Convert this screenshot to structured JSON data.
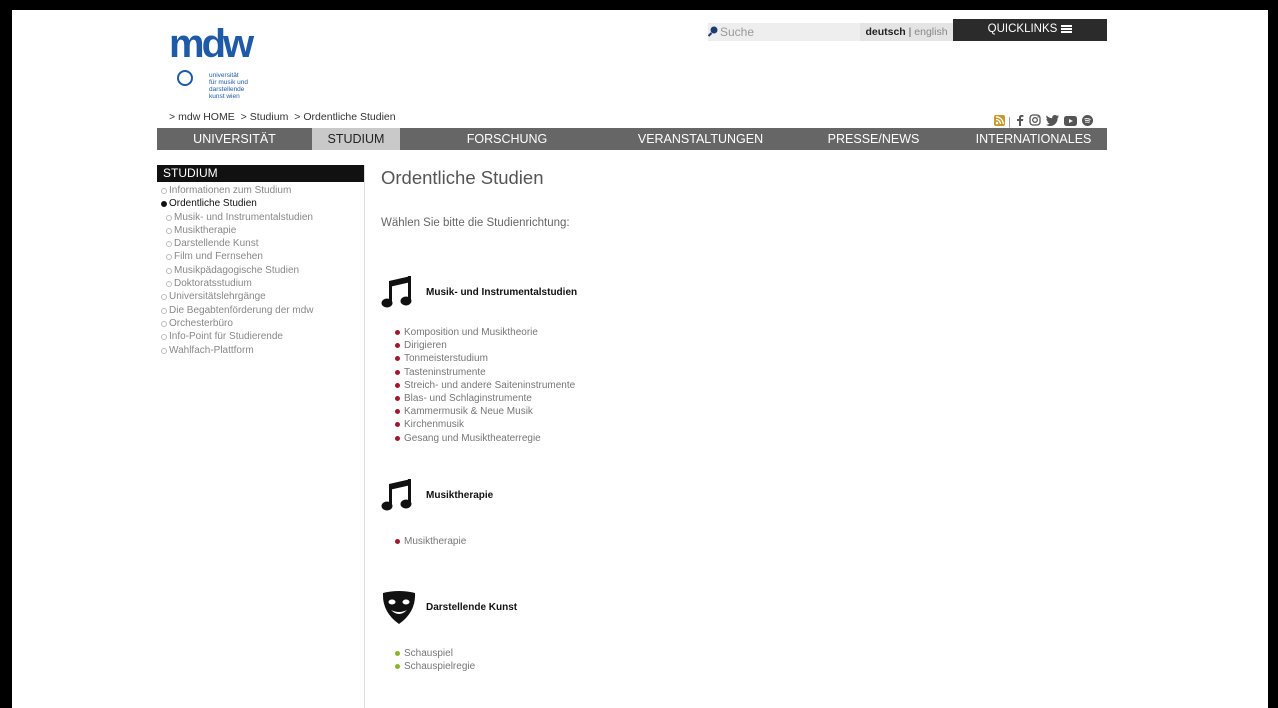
{
  "logo": {
    "text": "mdw",
    "tagline": [
      "universität",
      "für musik und",
      "darstellende",
      "kunst wien"
    ]
  },
  "breadcrumb": [
    ">",
    "mdw HOME",
    ">",
    "Studium",
    ">",
    "Ordentliche Studien"
  ],
  "search": {
    "placeholder": "Suche"
  },
  "language": {
    "active": "deutsch",
    "separator": "|",
    "other": "english"
  },
  "quicklinks": {
    "label": "QUICKLINKS"
  },
  "social_icons": [
    "rss-icon",
    "facebook-icon",
    "instagram-icon",
    "twitter-icon",
    "youtube-icon",
    "spotify-icon"
  ],
  "nav": {
    "items": [
      {
        "label": "UNIVERSITÄT",
        "active": false
      },
      {
        "label": "STUDIUM",
        "active": true
      },
      {
        "label": "FORSCHUNG",
        "active": false
      },
      {
        "label": "VERANSTALTUNGEN",
        "active": false
      },
      {
        "label": "PRESSE/NEWS",
        "active": false
      },
      {
        "label": "INTERNATIONALES",
        "active": false
      }
    ]
  },
  "sidebar": {
    "heading": "STUDIUM",
    "items": [
      {
        "label": "Informationen zum Studium",
        "level": 0,
        "active": false
      },
      {
        "label": "Ordentliche Studien",
        "level": 0,
        "active": true
      },
      {
        "label": "Musik- und Instrumentalstudien",
        "level": 1,
        "active": false
      },
      {
        "label": "Musiktherapie",
        "level": 1,
        "active": false
      },
      {
        "label": "Darstellende Kunst",
        "level": 1,
        "active": false
      },
      {
        "label": "Film und Fernsehen",
        "level": 1,
        "active": false
      },
      {
        "label": "Musikpädagogische Studien",
        "level": 1,
        "active": false
      },
      {
        "label": "Doktoratsstudium",
        "level": 1,
        "active": false
      },
      {
        "label": "Universitätslehrgänge",
        "level": 0,
        "active": false
      },
      {
        "label": "Die Begabtenförderung der mdw",
        "level": 0,
        "active": false
      },
      {
        "label": "Orchesterbüro",
        "level": 0,
        "active": false
      },
      {
        "label": "Info-Point für Studierende",
        "level": 0,
        "active": false
      },
      {
        "label": "Wahlfach-Plattform",
        "level": 0,
        "active": false
      }
    ]
  },
  "main": {
    "title": "Ordentliche Studien",
    "intro": "Wählen Sie bitte die Studienrichtung:",
    "sections": [
      {
        "title": "Musik- und Instrumentalstudien",
        "icon": "music-note-icon",
        "bullet_color": "#a0182c",
        "links": [
          "Komposition und Musiktheorie",
          "Dirigieren",
          "Tonmeisterstudium",
          "Tasteninstrumente",
          "Streich- und andere Saiteninstrumente",
          "Blas- und Schlaginstrumente",
          "Kammermusik & Neue Musik",
          "Kirchenmusik",
          "Gesang und Musiktheaterregie"
        ]
      },
      {
        "title": "Musiktherapie",
        "icon": "music-note-icon",
        "bullet_color": "#a0182c",
        "links": [
          "Musiktherapie"
        ]
      },
      {
        "title": "Darstellende Kunst",
        "icon": "theater-mask-icon",
        "bullet_color": "#8ab52a",
        "links": [
          "Schauspiel",
          "Schauspielregie"
        ]
      }
    ]
  },
  "colors": {
    "nav_bg": "#666666",
    "nav_active_bg": "#c9c9c9",
    "sidebar_head_bg": "#111111",
    "logo_blue": "#1f5aa8"
  }
}
